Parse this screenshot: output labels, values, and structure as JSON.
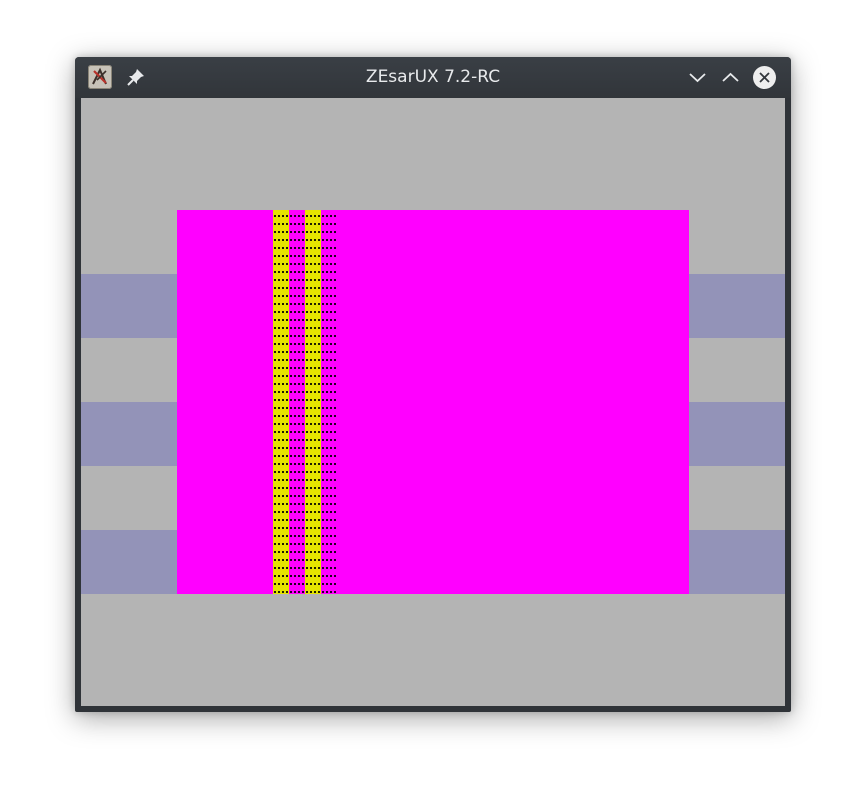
{
  "window": {
    "title": "ZEsarUX 7.2-RC"
  },
  "titlebar_icons": {
    "app": "zesarux-app-icon",
    "pin": "pin-icon",
    "minimize": "chevron-down-icon",
    "maximize": "chevron-up-icon",
    "close": "close-icon"
  },
  "colors": {
    "titlebar": "#33373c",
    "border_area": "#b4b4b4",
    "border_band": "#9393b8",
    "paper": "#ff00ff",
    "ink_stripe": "#e5e400",
    "dot": "#000000"
  }
}
